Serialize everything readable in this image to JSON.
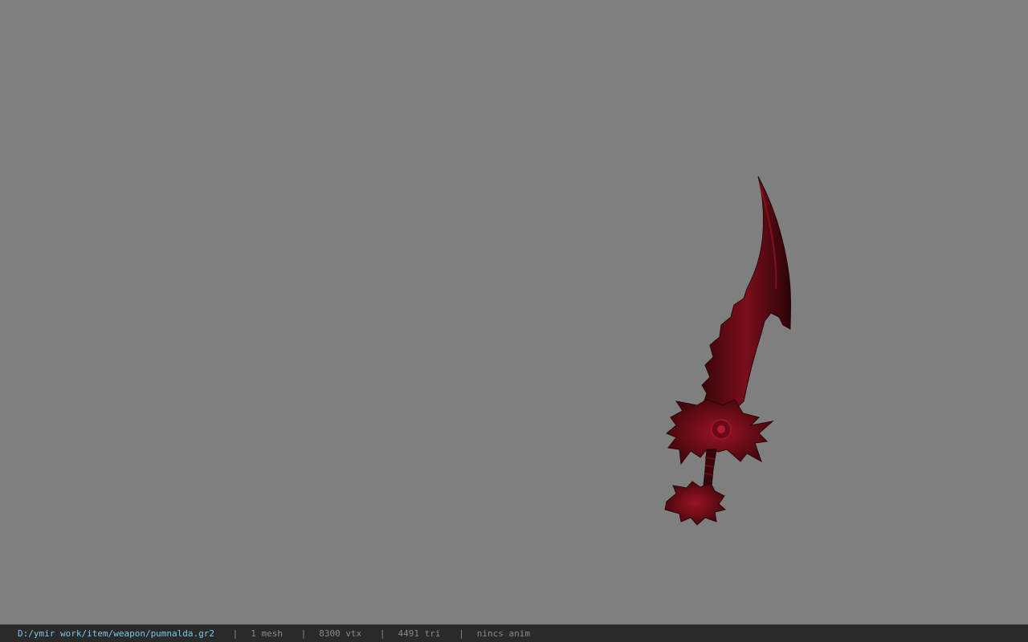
{
  "viewport": {
    "background_color": "#7f7f7f",
    "model_color": "#5a0a14"
  },
  "statusbar": {
    "file_path": "D:/ymir work/item/weapon/pumnalda.gr2",
    "separator": "|",
    "mesh_count": "1 mesh",
    "vertex_count": "8300 vtx",
    "triangle_count": "4491 tri",
    "animation": "nincs anim",
    "path_color": "#7ec8e8",
    "text_color": "#8a8a8a"
  }
}
